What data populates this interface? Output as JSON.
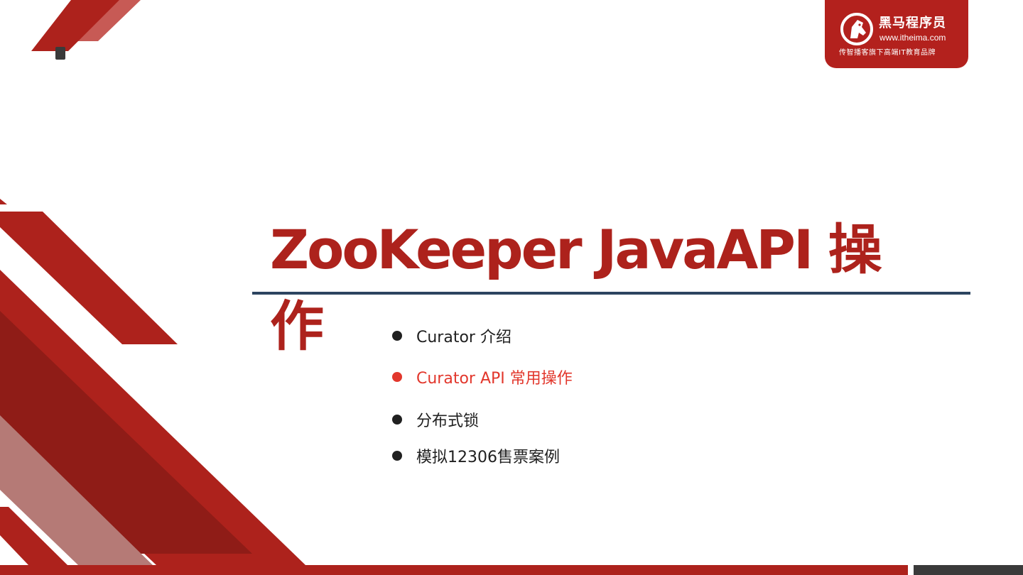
{
  "brand": {
    "name": "黑马程序员",
    "url": "www.itheima.com",
    "slogan": "传智播客旗下高端IT教育品牌"
  },
  "slide": {
    "title": "ZooKeeper JavaAPI 操作"
  },
  "agenda": [
    {
      "label": "Curator 介绍",
      "active": false
    },
    {
      "label": "Curator API 常用操作",
      "active": true
    },
    {
      "label": "分布式锁",
      "active": false
    },
    {
      "label": "模拟12306售票案例",
      "active": false
    }
  ],
  "colors": {
    "brand_red": "#ad221c",
    "active_item": "#e2372c",
    "rule_navy": "#2c4460",
    "text": "#202020"
  },
  "icons": {
    "logo": "horse-head-logo-icon",
    "bullet": "bullet-dot-icon"
  }
}
